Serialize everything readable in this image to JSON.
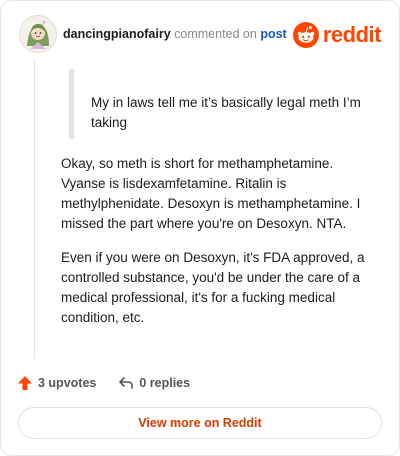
{
  "header": {
    "username": "dancingpianofairy",
    "action_text": "commented on",
    "post_link": "post",
    "logo_text": "reddit"
  },
  "quote": {
    "text": "My in laws tell me it’s basically legal meth I’m taking"
  },
  "comment": {
    "paragraphs": [
      "Okay, so meth is short for methamphetamine. Vyanse is lisdexamfetamine. Ritalin is methylphenidate. Desoxyn is methamphetamine. I missed the part where you're on Desoxyn. NTA.",
      "Even if you were on Desoxyn, it's FDA approved, a controlled substance, you'd be under the care of a medical professional, it's for a fucking medical condition, etc."
    ]
  },
  "actions": {
    "upvotes": "3 upvotes",
    "replies": "0 replies"
  },
  "view_button": "View more on Reddit",
  "colors": {
    "brand": "#ff4500",
    "upvote": "#ff4500",
    "link": "#1a56c6",
    "button_text": "#d93a00"
  },
  "icons": {
    "logo": "reddit-alien-icon",
    "upvote": "upvote-arrow-icon",
    "reply": "reply-arrow-icon"
  }
}
